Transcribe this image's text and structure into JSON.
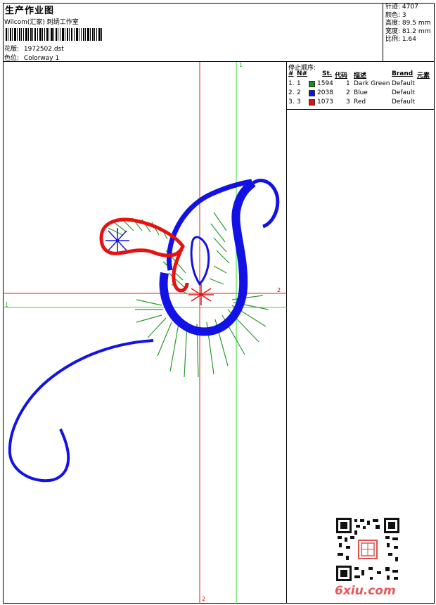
{
  "header": {
    "title": "生产作业图",
    "studio": "Wilcom(汇家) 刺绣工作室",
    "pattern_label": "花版:",
    "pattern_value": "1972502.dst",
    "color_label": "色位:",
    "color_value": "Colorway 1"
  },
  "stats": {
    "stitches_label": "针迹:",
    "stitches_value": "4707",
    "colors_label": "颜色:",
    "colors_value": "3",
    "height_label": "高度:",
    "height_value": "89.5 mm",
    "width_label": "宽度:",
    "width_value": "81.2 mm",
    "scale_label": "比例:",
    "scale_value": "1.64"
  },
  "stop_sequence": {
    "title": "停止顺序:",
    "headers": {
      "num": "#",
      "n": "N#",
      "st": "St.",
      "code": "代码",
      "desc": "描述",
      "brand": "Brand",
      "elem": "元素"
    },
    "rows": [
      {
        "num": "1.",
        "n": "1",
        "color": "#1a8a1a",
        "st": "1594",
        "code": "1",
        "desc": "Dark Green",
        "brand": "Default"
      },
      {
        "num": "2.",
        "n": "2",
        "color": "#1010e0",
        "st": "2038",
        "code": "2",
        "desc": "Blue",
        "brand": "Default"
      },
      {
        "num": "3.",
        "n": "3",
        "color": "#e01010",
        "st": "1073",
        "code": "3",
        "desc": "Red",
        "brand": "Default"
      }
    ]
  },
  "axes": {
    "green_top": "1",
    "green_left": "1",
    "red_right": "2",
    "red_bottom": "2"
  },
  "watermark": {
    "site": "6xiu.com",
    "qr_icon": "qr-code-icon",
    "seal_icon": "seal-icon"
  },
  "colors": {
    "green": "#2a9a2a",
    "blue": "#1212e6",
    "red": "#e61212",
    "axis_green": "#33dd33",
    "axis_red": "#dd2222",
    "watermark": "#e8565a"
  }
}
